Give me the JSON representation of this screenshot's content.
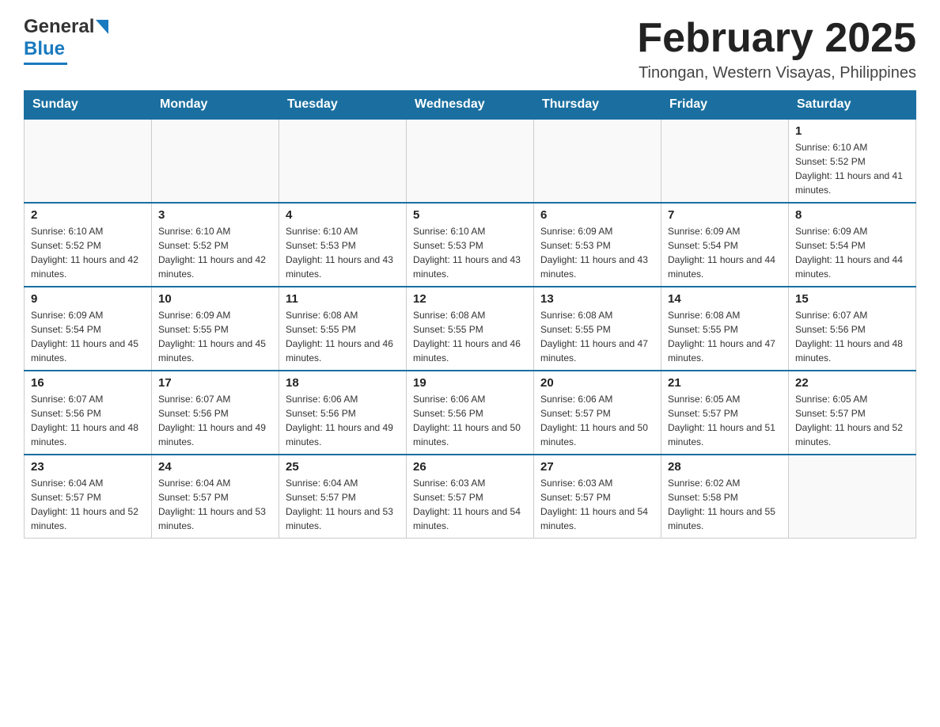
{
  "header": {
    "logo_general": "General",
    "logo_blue": "Blue",
    "month_title": "February 2025",
    "location": "Tinongan, Western Visayas, Philippines"
  },
  "days_of_week": [
    "Sunday",
    "Monday",
    "Tuesday",
    "Wednesday",
    "Thursday",
    "Friday",
    "Saturday"
  ],
  "weeks": [
    [
      {
        "day": "",
        "info": ""
      },
      {
        "day": "",
        "info": ""
      },
      {
        "day": "",
        "info": ""
      },
      {
        "day": "",
        "info": ""
      },
      {
        "day": "",
        "info": ""
      },
      {
        "day": "",
        "info": ""
      },
      {
        "day": "1",
        "info": "Sunrise: 6:10 AM\nSunset: 5:52 PM\nDaylight: 11 hours and 41 minutes."
      }
    ],
    [
      {
        "day": "2",
        "info": "Sunrise: 6:10 AM\nSunset: 5:52 PM\nDaylight: 11 hours and 42 minutes."
      },
      {
        "day": "3",
        "info": "Sunrise: 6:10 AM\nSunset: 5:52 PM\nDaylight: 11 hours and 42 minutes."
      },
      {
        "day": "4",
        "info": "Sunrise: 6:10 AM\nSunset: 5:53 PM\nDaylight: 11 hours and 43 minutes."
      },
      {
        "day": "5",
        "info": "Sunrise: 6:10 AM\nSunset: 5:53 PM\nDaylight: 11 hours and 43 minutes."
      },
      {
        "day": "6",
        "info": "Sunrise: 6:09 AM\nSunset: 5:53 PM\nDaylight: 11 hours and 43 minutes."
      },
      {
        "day": "7",
        "info": "Sunrise: 6:09 AM\nSunset: 5:54 PM\nDaylight: 11 hours and 44 minutes."
      },
      {
        "day": "8",
        "info": "Sunrise: 6:09 AM\nSunset: 5:54 PM\nDaylight: 11 hours and 44 minutes."
      }
    ],
    [
      {
        "day": "9",
        "info": "Sunrise: 6:09 AM\nSunset: 5:54 PM\nDaylight: 11 hours and 45 minutes."
      },
      {
        "day": "10",
        "info": "Sunrise: 6:09 AM\nSunset: 5:55 PM\nDaylight: 11 hours and 45 minutes."
      },
      {
        "day": "11",
        "info": "Sunrise: 6:08 AM\nSunset: 5:55 PM\nDaylight: 11 hours and 46 minutes."
      },
      {
        "day": "12",
        "info": "Sunrise: 6:08 AM\nSunset: 5:55 PM\nDaylight: 11 hours and 46 minutes."
      },
      {
        "day": "13",
        "info": "Sunrise: 6:08 AM\nSunset: 5:55 PM\nDaylight: 11 hours and 47 minutes."
      },
      {
        "day": "14",
        "info": "Sunrise: 6:08 AM\nSunset: 5:55 PM\nDaylight: 11 hours and 47 minutes."
      },
      {
        "day": "15",
        "info": "Sunrise: 6:07 AM\nSunset: 5:56 PM\nDaylight: 11 hours and 48 minutes."
      }
    ],
    [
      {
        "day": "16",
        "info": "Sunrise: 6:07 AM\nSunset: 5:56 PM\nDaylight: 11 hours and 48 minutes."
      },
      {
        "day": "17",
        "info": "Sunrise: 6:07 AM\nSunset: 5:56 PM\nDaylight: 11 hours and 49 minutes."
      },
      {
        "day": "18",
        "info": "Sunrise: 6:06 AM\nSunset: 5:56 PM\nDaylight: 11 hours and 49 minutes."
      },
      {
        "day": "19",
        "info": "Sunrise: 6:06 AM\nSunset: 5:56 PM\nDaylight: 11 hours and 50 minutes."
      },
      {
        "day": "20",
        "info": "Sunrise: 6:06 AM\nSunset: 5:57 PM\nDaylight: 11 hours and 50 minutes."
      },
      {
        "day": "21",
        "info": "Sunrise: 6:05 AM\nSunset: 5:57 PM\nDaylight: 11 hours and 51 minutes."
      },
      {
        "day": "22",
        "info": "Sunrise: 6:05 AM\nSunset: 5:57 PM\nDaylight: 11 hours and 52 minutes."
      }
    ],
    [
      {
        "day": "23",
        "info": "Sunrise: 6:04 AM\nSunset: 5:57 PM\nDaylight: 11 hours and 52 minutes."
      },
      {
        "day": "24",
        "info": "Sunrise: 6:04 AM\nSunset: 5:57 PM\nDaylight: 11 hours and 53 minutes."
      },
      {
        "day": "25",
        "info": "Sunrise: 6:04 AM\nSunset: 5:57 PM\nDaylight: 11 hours and 53 minutes."
      },
      {
        "day": "26",
        "info": "Sunrise: 6:03 AM\nSunset: 5:57 PM\nDaylight: 11 hours and 54 minutes."
      },
      {
        "day": "27",
        "info": "Sunrise: 6:03 AM\nSunset: 5:57 PM\nDaylight: 11 hours and 54 minutes."
      },
      {
        "day": "28",
        "info": "Sunrise: 6:02 AM\nSunset: 5:58 PM\nDaylight: 11 hours and 55 minutes."
      },
      {
        "day": "",
        "info": ""
      }
    ]
  ]
}
